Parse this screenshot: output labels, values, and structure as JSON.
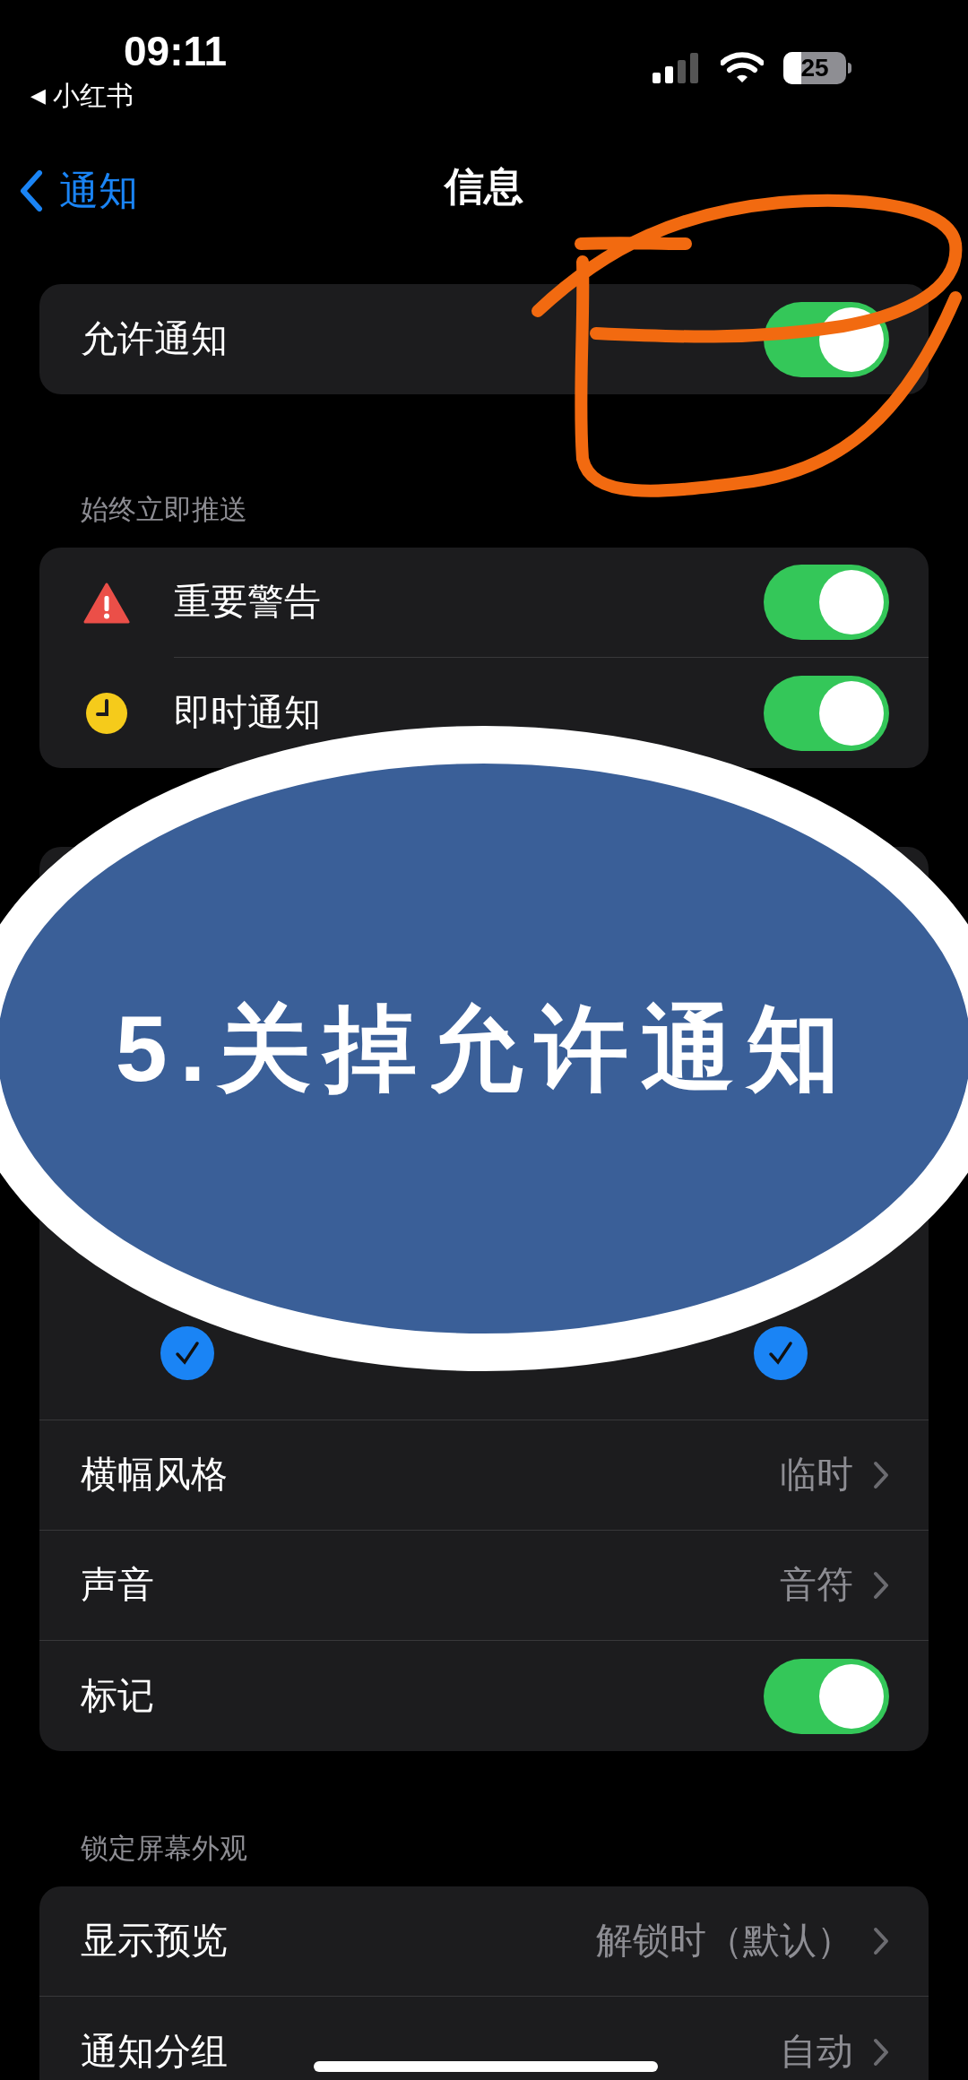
{
  "status_bar": {
    "time": "09:11",
    "back_glyph": "◀",
    "back_app": "小红书",
    "battery": "25"
  },
  "nav": {
    "back_label": "通知",
    "title": "信息"
  },
  "groups": [
    {
      "rows": [
        {
          "kind": "toggle",
          "label": "允许通知",
          "on": true
        }
      ]
    },
    {
      "header": "始终立即推送",
      "rows": [
        {
          "kind": "toggle",
          "label": "重要警告",
          "on": true
        },
        {
          "kind": "toggle",
          "label": "即时通知",
          "on": true
        }
      ]
    },
    {
      "alert_styles": [
        {
          "checked": true
        },
        {
          "checked": true
        }
      ],
      "rows": [
        {
          "kind": "disclosure",
          "label": "横幅风格",
          "value": "临时"
        },
        {
          "kind": "disclosure",
          "label": "声音",
          "value": "音符"
        },
        {
          "kind": "toggle",
          "label": "标记",
          "on": true
        }
      ]
    },
    {
      "header": "锁定屏幕外观",
      "rows": [
        {
          "kind": "disclosure",
          "label": "显示预览",
          "value": "解锁时（默认）"
        },
        {
          "kind": "disclosure",
          "label": "通知分组",
          "value": "自动"
        }
      ]
    }
  ],
  "overlay": {
    "text": "5.关掉允许通知"
  }
}
